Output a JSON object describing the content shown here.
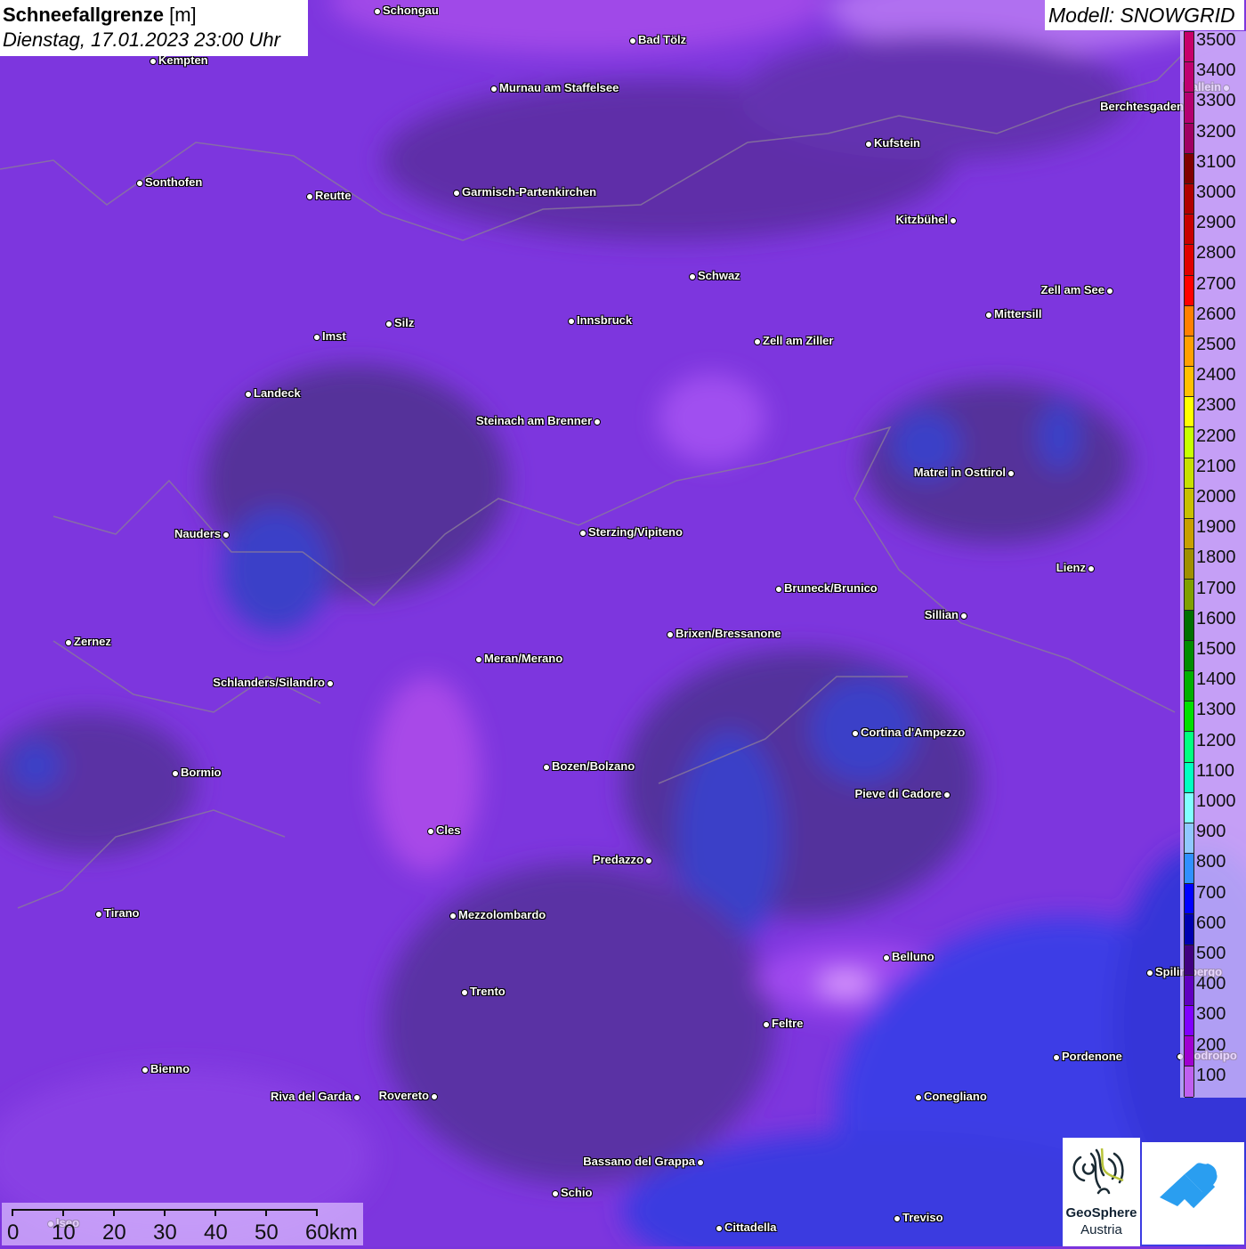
{
  "header": {
    "title": "Schneefallgrenze",
    "unit": "[m]",
    "datetime": "Dienstag, 17.01.2023 23:00 Uhr"
  },
  "model_label": "Modell: SNOWGRID",
  "legend": {
    "labels": [
      "3500",
      "3400",
      "3300",
      "3200",
      "3100",
      "3000",
      "2900",
      "2800",
      "2700",
      "2600",
      "2500",
      "2400",
      "2300",
      "2200",
      "2100",
      "2000",
      "1900",
      "1800",
      "1700",
      "1600",
      "1500",
      "1400",
      "1300",
      "1200",
      "1100",
      "1000",
      "900",
      "800",
      "700",
      "600",
      "500",
      "400",
      "300",
      "200",
      "100"
    ],
    "colors": [
      "#c8006a",
      "#c00070",
      "#b40070",
      "#a00062",
      "#800000",
      "#b00000",
      "#c80000",
      "#e00000",
      "#ff0000",
      "#ff8000",
      "#ffa000",
      "#ffc000",
      "#ffff00",
      "#c8ff00",
      "#c8e000",
      "#c8c000",
      "#c8a000",
      "#a09000",
      "#80a000",
      "#007000",
      "#008c00",
      "#00b000",
      "#00e000",
      "#00ff80",
      "#00ffc0",
      "#80ffff",
      "#90c8ff",
      "#3090ff",
      "#0000ff",
      "#0000b0",
      "#400080",
      "#6000c0",
      "#8000ff",
      "#a000d0",
      "#c060f0"
    ]
  },
  "scale": {
    "labels": [
      "0",
      "10",
      "20",
      "30",
      "40",
      "50",
      "60km"
    ]
  },
  "cities": [
    "Schongau",
    "Bad Tölz",
    "Kempten",
    "Murnau am Staffelsee",
    "Hallein",
    "Berchtesgaden",
    "Kufstein",
    "Sonthofen",
    "Reutte",
    "Garmisch-Partenkirchen",
    "Kitzbühel",
    "Schwaz",
    "Zell am See",
    "Mittersill",
    "Innsbruck",
    "Silz",
    "Imst",
    "Zell am Ziller",
    "Landeck",
    "Steinach am Brenner",
    "Matrei in Osttirol",
    "Nauders",
    "Sterzing/Vipiteno",
    "Lienz",
    "Bruneck/Brunico",
    "Sillian",
    "Brixen/Bressanone",
    "Zernez",
    "Meran/Merano",
    "Schlanders/Silandro",
    "Cortina d'Ampezzo",
    "Bozen/Bolzano",
    "Bormio",
    "Pieve di Cadore",
    "Cles",
    "Predazzo",
    "Tirano",
    "Mezzolombardo",
    "Belluno",
    "Spilimbergo",
    "Trento",
    "Feltre",
    "Pordenone",
    "Codroipo",
    "Bienno",
    "Riva del Garda",
    "Rovereto",
    "Conegliano",
    "Bassano del Grappa",
    "Schio",
    "Iseo",
    "Treviso",
    "Cittadella"
  ],
  "logos": {
    "geosphere_line1": "GeoSphere",
    "geosphere_line2": "Austria"
  }
}
